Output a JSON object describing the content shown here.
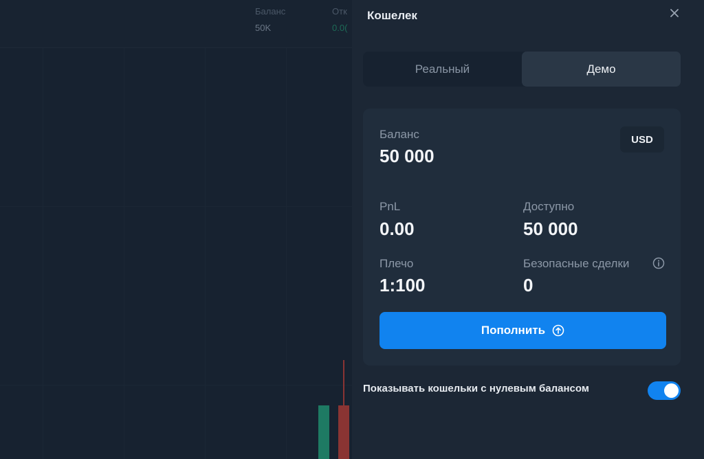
{
  "background": {
    "stats": [
      {
        "label": "Баланс",
        "value": "50K"
      },
      {
        "label": "Отк",
        "value": "0.0("
      }
    ]
  },
  "wallet": {
    "title": "Кошелек",
    "close_icon": "close-icon",
    "tabs": [
      {
        "label": "Реальный",
        "active": false
      },
      {
        "label": "Демо",
        "active": true
      }
    ],
    "currency": "USD",
    "balance": {
      "label": "Баланс",
      "value": "50 000"
    },
    "pnl": {
      "label": "PnL",
      "value": "0.00"
    },
    "available": {
      "label": "Доступно",
      "value": "50 000"
    },
    "leverage": {
      "label": "Плечо",
      "value": "1:100"
    },
    "safe_trades": {
      "label": "Безопасные сделки",
      "value": "0",
      "icon": "info-icon"
    },
    "deposit_button": {
      "label": "Пополнить",
      "icon": "arrow-up-circle-icon"
    },
    "show_zero_balance": {
      "label": "Показывать кошельки с нулевым балансом",
      "enabled": true
    }
  },
  "colors": {
    "accent": "#1183ef",
    "panel_bg": "#1c2735",
    "card_bg": "#202d3c",
    "candle_green": "#1e7a63",
    "candle_red": "#8a3433"
  }
}
